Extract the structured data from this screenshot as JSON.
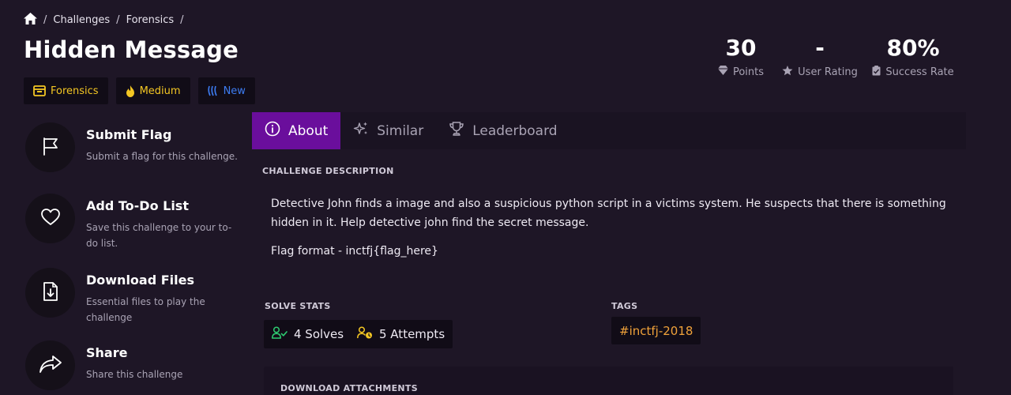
{
  "breadcrumb": {
    "home_icon": "home-icon",
    "items": [
      "Challenges",
      "Forensics"
    ],
    "separator": "/"
  },
  "title": "Hidden Message",
  "badges": {
    "category": "Forensics",
    "difficulty": "Medium",
    "status": "New"
  },
  "stats": {
    "points": {
      "value": "30",
      "label": "Points"
    },
    "rating": {
      "value": "-",
      "label": "User Rating"
    },
    "success": {
      "value": "80%",
      "label": "Success Rate"
    }
  },
  "actions": [
    {
      "title": "Submit Flag",
      "subtitle": "Submit a flag for this challenge."
    },
    {
      "title": "Add To-Do List",
      "subtitle": "Save this challenge to your to-do list."
    },
    {
      "title": "Download Files",
      "subtitle": "Essential files to play the challenge"
    },
    {
      "title": "Share",
      "subtitle": "Share this challenge"
    }
  ],
  "tabs": [
    "About",
    "Similar",
    "Leaderboard"
  ],
  "about": {
    "description_label": "CHALLENGE DESCRIPTION",
    "description": "Detective John finds a image and also a suspicious python script in a victims system. He suspects that there is something hidden in it. Help detective john find the secret message.",
    "flag_format": "Flag format - inctfj{flag_here}",
    "solve_stats_label": "SOLVE STATS",
    "solves": "4 Solves",
    "attempts": "5 Attempts",
    "tags_label": "TAGS",
    "tag": "#inctfj-2018",
    "attachments_label": "DOWNLOAD ATTACHMENTS"
  },
  "colors": {
    "background": "#1e1626",
    "accent": "#6a0e9c",
    "badge_yellow": "#f3c623",
    "badge_blue": "#3d7cf2",
    "tag_orange": "#f0a23a",
    "solve_green": "#2ecc71"
  }
}
